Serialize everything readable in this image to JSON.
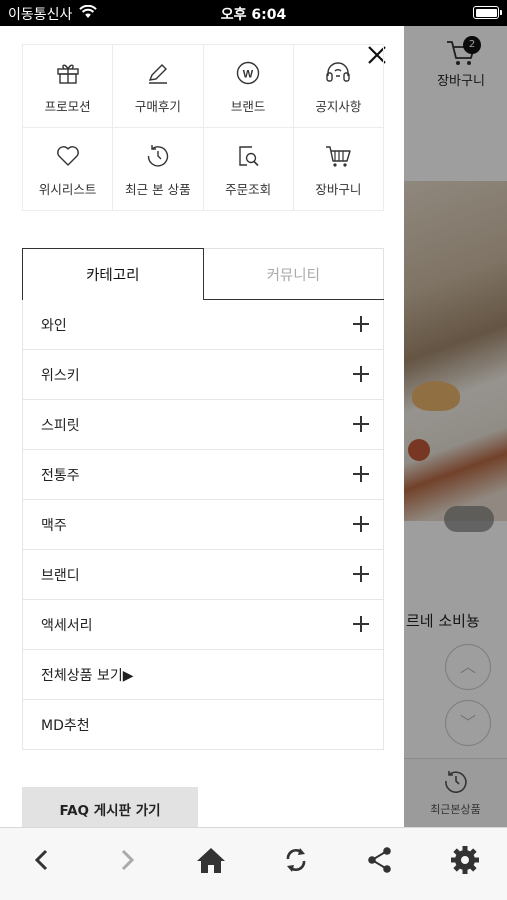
{
  "status_bar": {
    "carrier": "이동통신사",
    "time": "오후 6:04"
  },
  "background": {
    "cart": {
      "label": "장바구니",
      "badge": "2"
    },
    "promo_text": "르네 소비뇽",
    "recent_label": "최근본상품"
  },
  "quick_menu": [
    {
      "label": "프로모션",
      "icon": "gift-icon"
    },
    {
      "label": "구매후기",
      "icon": "pencil-icon"
    },
    {
      "label": "브랜드",
      "icon": "brand-w-icon"
    },
    {
      "label": "공지사항",
      "icon": "headset-icon"
    },
    {
      "label": "위시리스트",
      "icon": "heart-icon"
    },
    {
      "label": "최근 본 상품",
      "icon": "history-icon"
    },
    {
      "label": "주문조회",
      "icon": "order-search-icon"
    },
    {
      "label": "장바구니",
      "icon": "cart-icon"
    }
  ],
  "tabs": [
    {
      "label": "카테고리",
      "active": true
    },
    {
      "label": "커뮤니티",
      "active": false
    }
  ],
  "categories": [
    {
      "label": "와인",
      "expandable": true
    },
    {
      "label": "위스키",
      "expandable": true
    },
    {
      "label": "스피릿",
      "expandable": true
    },
    {
      "label": "전통주",
      "expandable": true
    },
    {
      "label": "맥주",
      "expandable": true
    },
    {
      "label": "브랜디",
      "expandable": true
    },
    {
      "label": "액세서리",
      "expandable": true
    },
    {
      "label": "전체상품 보기▶",
      "expandable": false
    },
    {
      "label": "MD추천",
      "expandable": false
    }
  ],
  "faq_button": "FAQ 게시판 가기",
  "toolbar": [
    "back-icon",
    "forward-icon",
    "home-icon",
    "refresh-icon",
    "share-icon",
    "settings-icon"
  ]
}
